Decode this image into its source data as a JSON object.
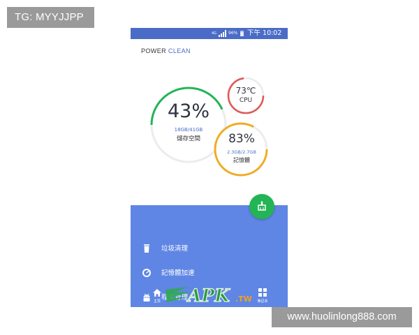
{
  "watermarks": {
    "tg": "TG: MYYJJPP",
    "site": "www.huolinlong888.com",
    "apk_logo_text": "APK.TW"
  },
  "status_bar": {
    "network": "4G",
    "battery": "96%",
    "time": "下午 10:02"
  },
  "app": {
    "brand_part1": "POWER",
    "brand_part2": "CLEAN",
    "accent": "#4b6cc6"
  },
  "storage": {
    "percent": "43%",
    "used": "18GB/41GB",
    "label": "儲存空間",
    "fill": 0.43,
    "color": "#23b455"
  },
  "cpu": {
    "temp": "73℃",
    "label": "CPU",
    "color": "#e05a5a"
  },
  "memory": {
    "percent": "83%",
    "used": "2.3GB/2.7GB",
    "label": "記憶體",
    "fill": 0.83,
    "color": "#f0ac22"
  },
  "menu": [
    {
      "label": "垃圾清理",
      "icon": "trash-icon"
    },
    {
      "label": "記憶體加速",
      "icon": "speedometer-icon"
    },
    {
      "label": "程式管理",
      "icon": "android-icon"
    }
  ],
  "bottom_nav": {
    "home_label": "主頁",
    "right_label": "筆記本"
  },
  "fab": {
    "icon": "broom-icon"
  }
}
